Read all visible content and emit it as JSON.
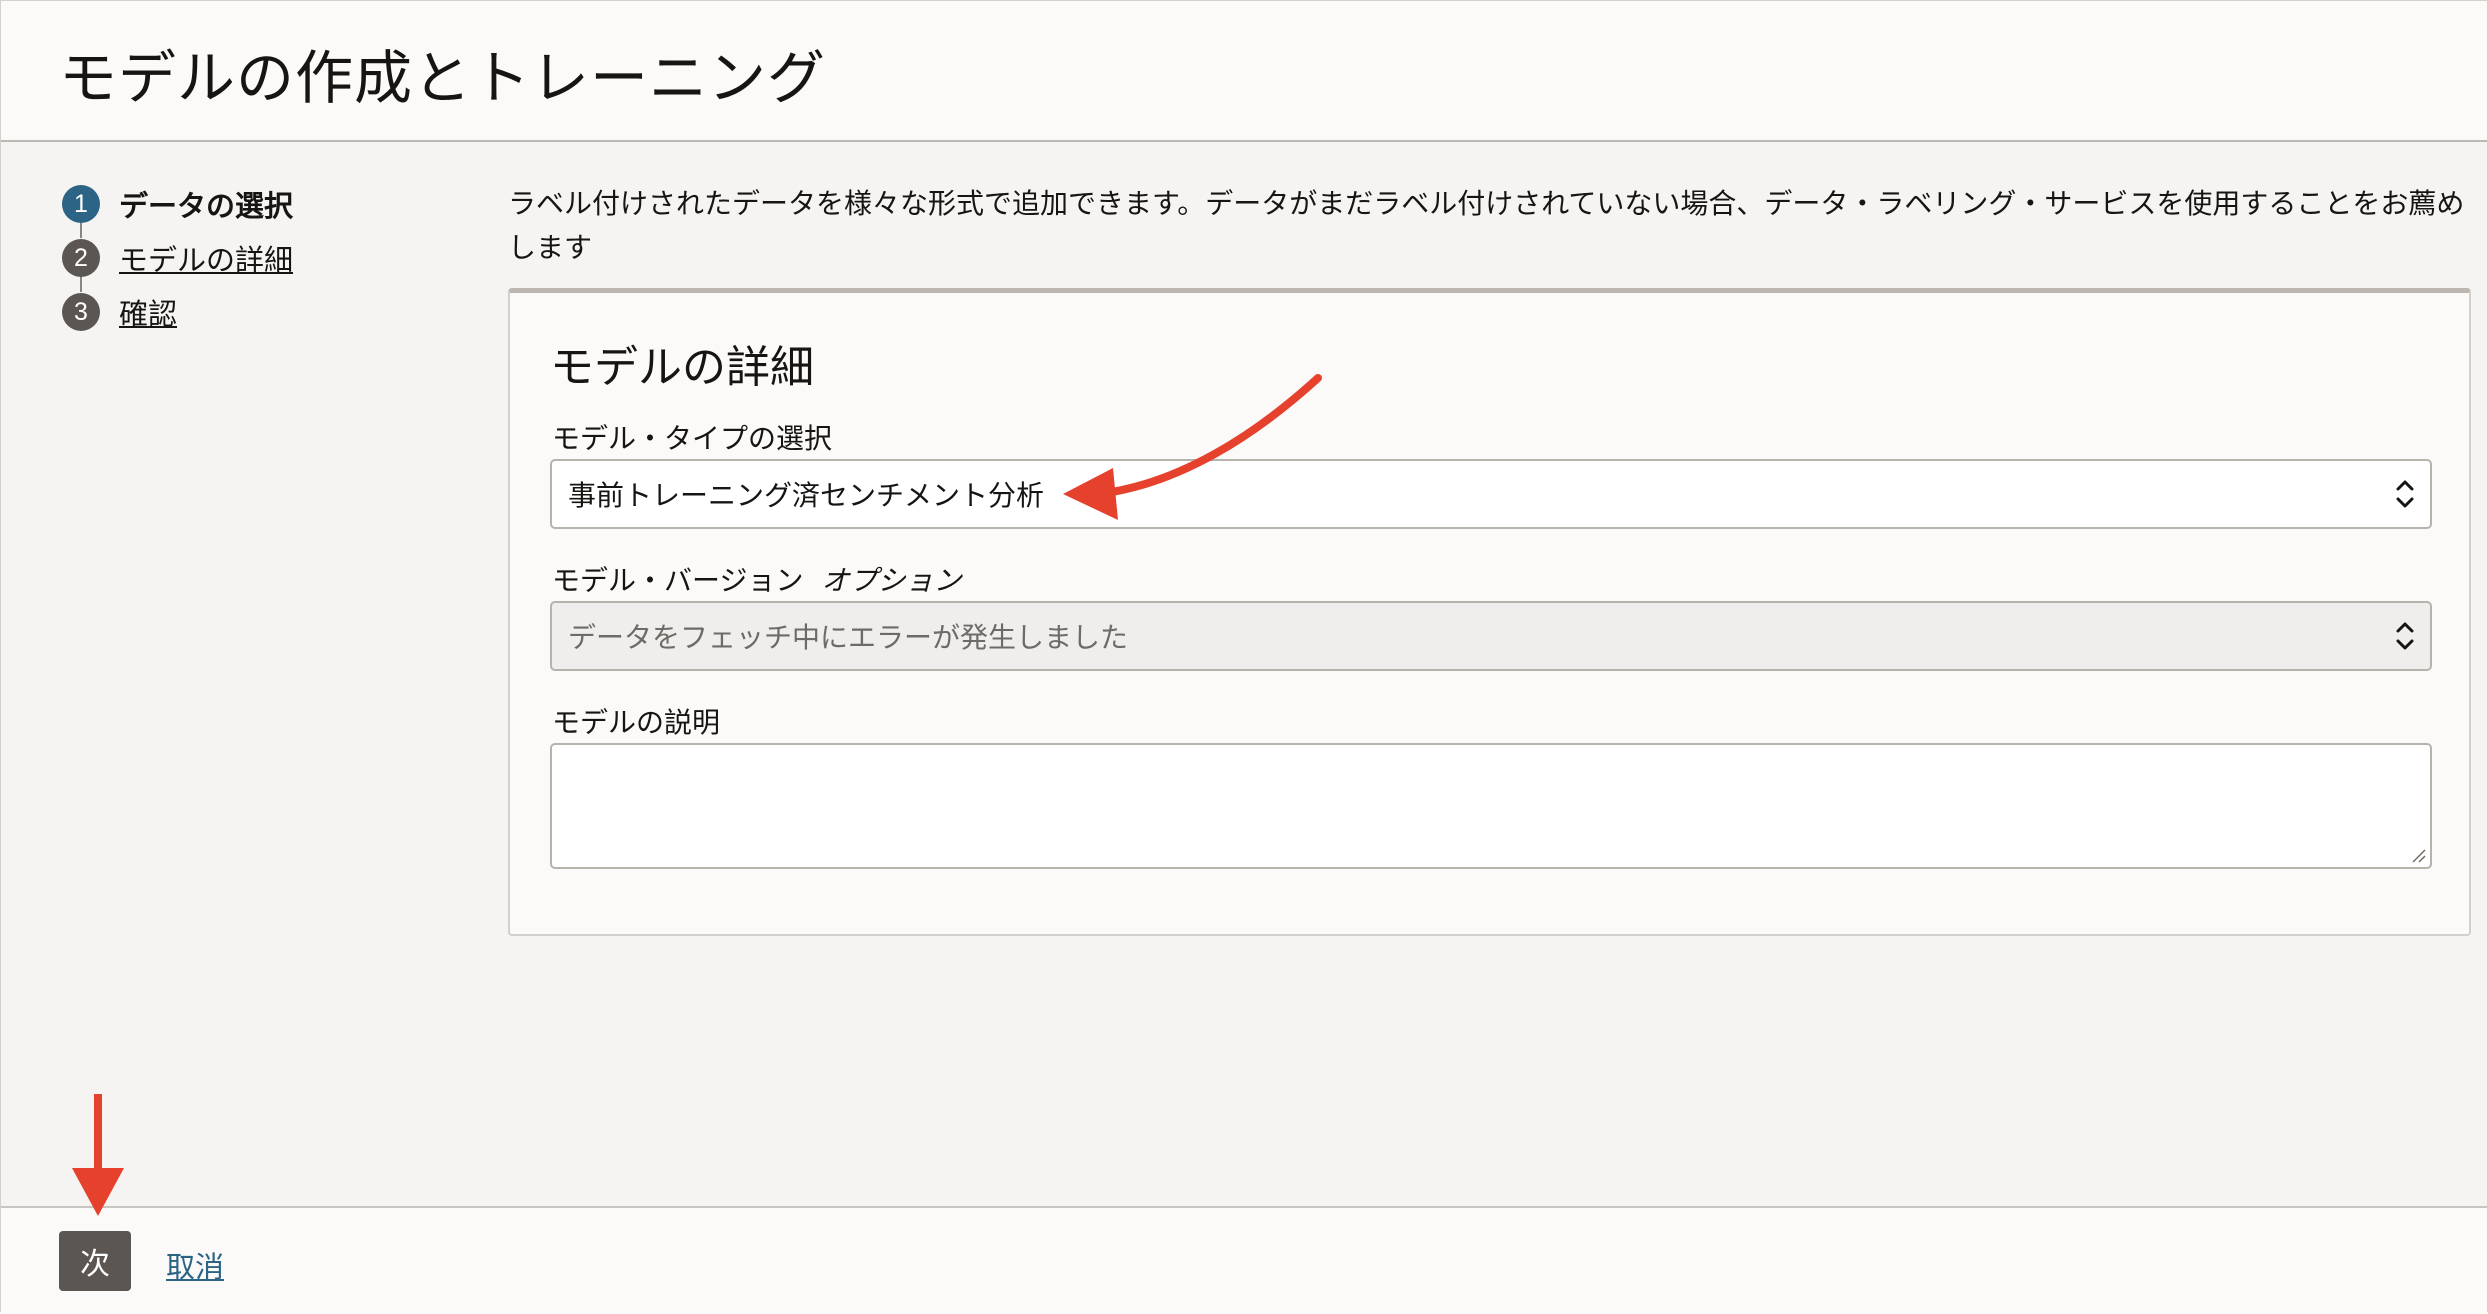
{
  "page": {
    "title": "モデルの作成とトレーニング"
  },
  "steps": [
    {
      "number": "1",
      "label": "データの選択",
      "active": true
    },
    {
      "number": "2",
      "label": "モデルの詳細",
      "active": false
    },
    {
      "number": "3",
      "label": "確認",
      "active": false
    }
  ],
  "intro": {
    "text": "ラベル付けされたデータを様々な形式で追加できます。データがまだラベル付けされていない場合、データ・ラベリング・サービスを使用することをお薦めします"
  },
  "card": {
    "title": "モデルの詳細",
    "model_type": {
      "label": "モデル・タイプの選択",
      "value": "事前トレーニング済センチメント分析"
    },
    "model_version": {
      "label": "モデル・バージョン",
      "optional": "オプション",
      "value": "データをフェッチ中にエラーが発生しました"
    },
    "description": {
      "label": "モデルの説明",
      "value": ""
    }
  },
  "footer": {
    "next_label": "次",
    "cancel_label": "取消"
  },
  "colors": {
    "accent": "#2b6485",
    "annotation": "#e5412d",
    "button": "#5b5652"
  }
}
